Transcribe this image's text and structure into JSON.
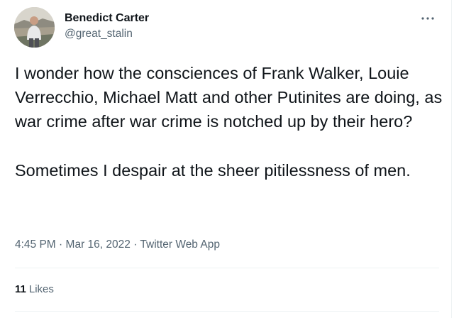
{
  "author": {
    "display_name": "Benedict Carter",
    "handle": "@great_stalin"
  },
  "tweet": {
    "paragraphs": [
      "I wonder how the consciences of Frank Walker, Louie Verrecchio, Michael Matt and other Putinites are doing, as war crime after war crime is notched up by their hero?",
      "Sometimes I despair at the sheer pitilessness of men."
    ]
  },
  "meta": {
    "time": "4:45 PM",
    "separator": "·",
    "date": "Mar 16, 2022",
    "source": "Twitter Web App"
  },
  "stats": {
    "likes_count": "11",
    "likes_label": "Likes"
  },
  "icons": {
    "more": "more-horizontal-icon",
    "avatar": "profile-photo"
  },
  "colors": {
    "text_primary": "#0f1419",
    "text_secondary": "#536471",
    "divider": "#eff3f4",
    "background": "#ffffff"
  }
}
